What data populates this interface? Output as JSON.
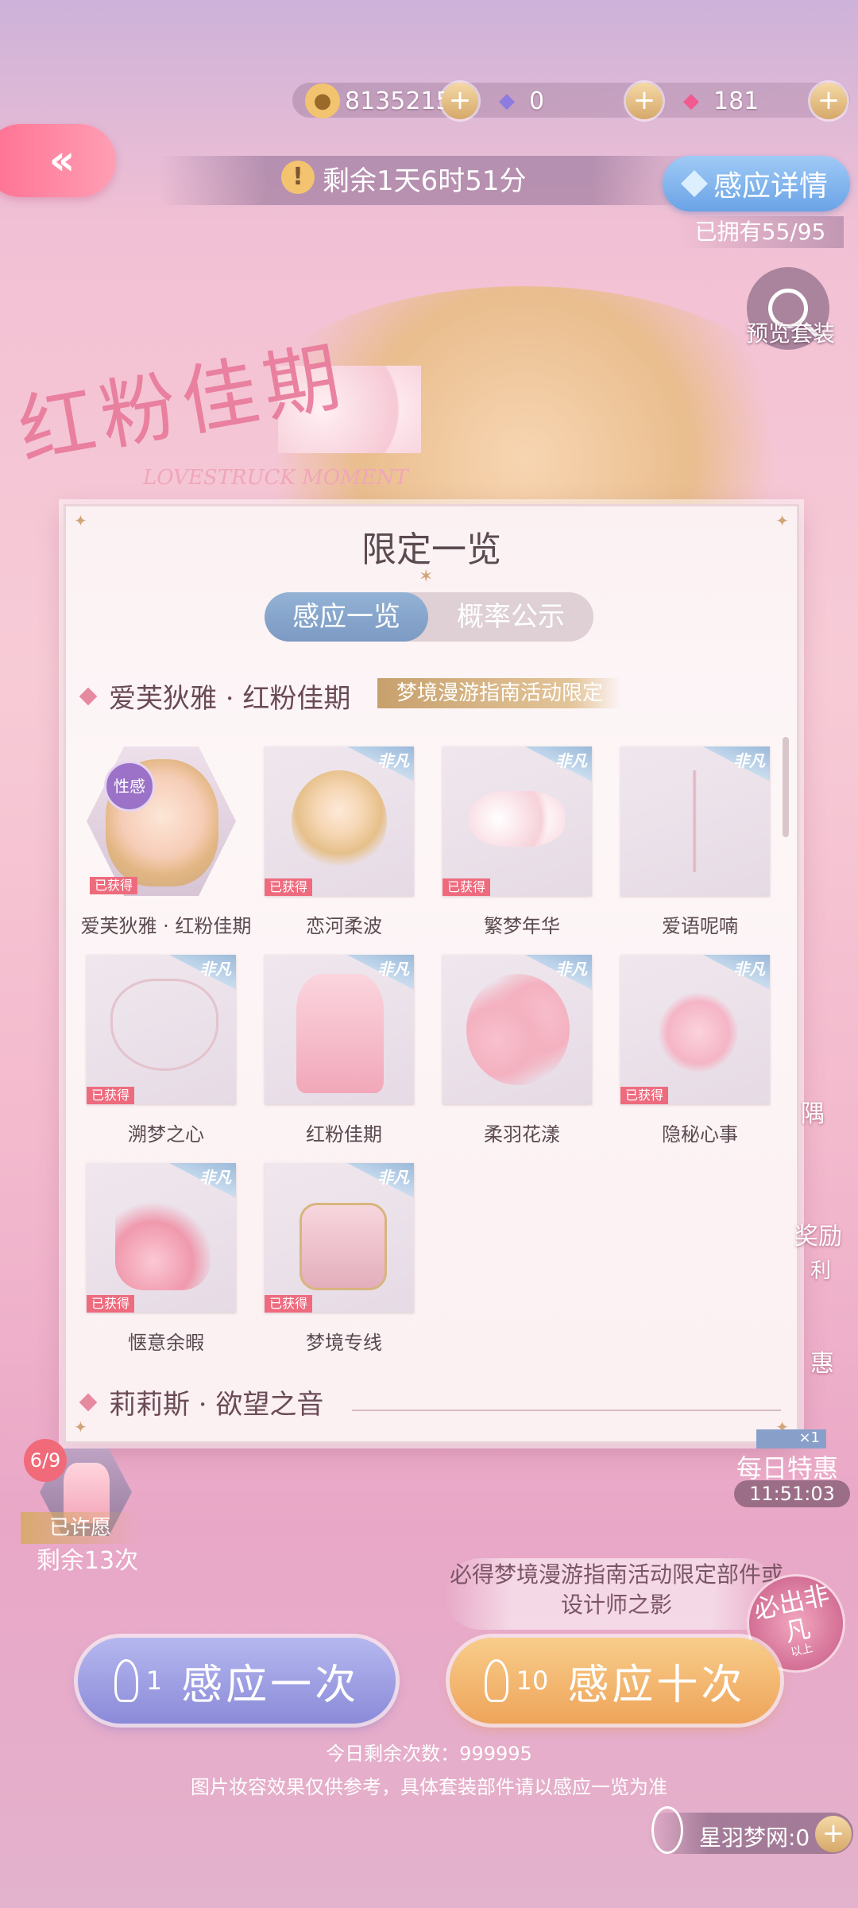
{
  "currency": {
    "gold": "8135215",
    "diamond": "0",
    "crystal": "181"
  },
  "timer": {
    "icon": "!",
    "text": "剩余1天6时51分"
  },
  "detail": {
    "label": "感应详情",
    "owned": "已拥有55/95"
  },
  "preview": {
    "label": "预览套装"
  },
  "background": {
    "title_cn": "红粉佳期",
    "title_en": "LOVESTRUCK MOMENT"
  },
  "modal": {
    "title": "限定一览",
    "tabs": [
      "感应一览",
      "概率公示"
    ],
    "section1": {
      "name": "爱芙狄雅 · 红粉佳期",
      "tag": "梦境漫游指南活动限定"
    },
    "rarity_ribbon": "非凡",
    "obtained_label": "已获得",
    "items": [
      {
        "label": "爱芙狄雅 · 红粉佳期",
        "badge": "性感",
        "obtained": true
      },
      {
        "label": "恋河柔波",
        "obtained": true
      },
      {
        "label": "繁梦年华",
        "obtained": true
      },
      {
        "label": "爱语呢喃",
        "obtained": false
      },
      {
        "label": "溯梦之心",
        "obtained": true
      },
      {
        "label": "红粉佳期",
        "obtained": false
      },
      {
        "label": "柔羽花漾",
        "obtained": false
      },
      {
        "label": "隐秘心事",
        "obtained": true
      },
      {
        "label": "惬意余暇",
        "obtained": true
      },
      {
        "label": "梦境专线",
        "obtained": true
      }
    ],
    "section2": {
      "name": "莉莉斯 · 欲望之音"
    }
  },
  "wish": {
    "count": "6/9",
    "state": "已许愿",
    "remaining": "剩余13次"
  },
  "daily": {
    "badge": "×1",
    "label": "每日特惠",
    "time": "11:51:03"
  },
  "side_fragments": [
    "隅",
    "奖励",
    "利",
    "惠"
  ],
  "promo": {
    "text": "必得梦境漫游指南活动限定部件或设计师之影",
    "badge": "必出非凡",
    "badge_sub": "以上"
  },
  "draw": {
    "once_count": "1",
    "once_label": "感应一次",
    "ten_count": "10",
    "ten_label": "感应十次"
  },
  "footer": {
    "remaining_today": "今日剩余次数：999995",
    "disclaimer": "图片妆容效果仅供参考，具体套装部件请以感应一览为准",
    "dreamnet": "星羽梦网:0"
  },
  "colors": {
    "accent_pink": "#ff6f91",
    "obtained_red": "#ee6b7e",
    "tab_blue": "#7c9ac3",
    "gold": "#d6a869"
  }
}
